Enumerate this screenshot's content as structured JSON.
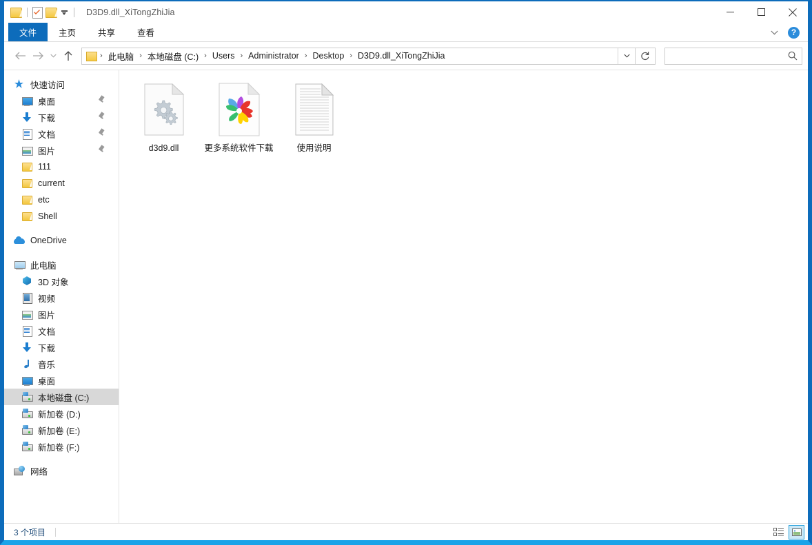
{
  "window": {
    "title": "D3D9.dll_XiTongZhiJia",
    "accent_color": "#0d6cbb",
    "bottom_border_color": "#1aa3e8",
    "controls": {
      "minimize": "minimize-icon",
      "maximize": "maximize-icon",
      "close": "close-icon"
    },
    "quick_access_toolbar": [
      {
        "name": "folder-icon",
        "label": ""
      },
      {
        "name": "properties-icon",
        "label": ""
      },
      {
        "name": "new-folder-icon",
        "label": ""
      },
      {
        "name": "customize-dropdown",
        "label": ""
      }
    ]
  },
  "ribbon": {
    "tabs": [
      {
        "id": "file",
        "label": "文件",
        "active": true
      },
      {
        "id": "home",
        "label": "主页",
        "active": false
      },
      {
        "id": "share",
        "label": "共享",
        "active": false
      },
      {
        "id": "view",
        "label": "查看",
        "active": false
      }
    ],
    "collapse_icon": "chevron-down-icon",
    "help_label": "?"
  },
  "address_bar": {
    "back_tooltip": "",
    "forward_tooltip": "",
    "up_tooltip": "",
    "breadcrumbs": [
      "此电脑",
      "本地磁盘 (C:)",
      "Users",
      "Administrator",
      "Desktop",
      "D3D9.dll_XiTongZhiJia"
    ],
    "separator": "›",
    "dropdown_icon": "chevron-down-icon",
    "refresh_icon": "refresh-icon"
  },
  "search": {
    "value": "",
    "placeholder": "",
    "icon": "search-icon"
  },
  "sidebar": {
    "groups": [
      {
        "header": {
          "label": "快速访问",
          "icon": "star-pin-icon"
        },
        "items": [
          {
            "label": "桌面",
            "icon": "desktop-icon",
            "pinned": true
          },
          {
            "label": "下载",
            "icon": "download-icon",
            "pinned": true
          },
          {
            "label": "文档",
            "icon": "documents-icon",
            "pinned": true
          },
          {
            "label": "图片",
            "icon": "pictures-icon",
            "pinned": true
          },
          {
            "label": "111",
            "icon": "folder-icon",
            "pinned": false
          },
          {
            "label": "current",
            "icon": "folder-icon",
            "pinned": false
          },
          {
            "label": "etc",
            "icon": "folder-icon",
            "pinned": false
          },
          {
            "label": "Shell",
            "icon": "folder-icon",
            "pinned": false
          }
        ]
      },
      {
        "header": {
          "label": "OneDrive",
          "icon": "onedrive-cloud-icon"
        },
        "items": []
      },
      {
        "header": {
          "label": "此电脑",
          "icon": "this-pc-icon"
        },
        "items": [
          {
            "label": "3D 对象",
            "icon": "3d-objects-icon",
            "pinned": false
          },
          {
            "label": "视频",
            "icon": "videos-icon",
            "pinned": false
          },
          {
            "label": "图片",
            "icon": "pictures-icon",
            "pinned": false
          },
          {
            "label": "文档",
            "icon": "documents-icon",
            "pinned": false
          },
          {
            "label": "下载",
            "icon": "download-icon",
            "pinned": false
          },
          {
            "label": "音乐",
            "icon": "music-icon",
            "pinned": false
          },
          {
            "label": "桌面",
            "icon": "desktop-icon",
            "pinned": false
          },
          {
            "label": "本地磁盘 (C:)",
            "icon": "local-disk-icon",
            "selected": true
          },
          {
            "label": "新加卷 (D:)",
            "icon": "drive-icon",
            "pinned": false
          },
          {
            "label": "新加卷 (E:)",
            "icon": "drive-icon",
            "pinned": false
          },
          {
            "label": "新加卷 (F:)",
            "icon": "drive-icon",
            "pinned": false
          }
        ]
      },
      {
        "header": {
          "label": "网络",
          "icon": "network-icon"
        },
        "items": []
      }
    ]
  },
  "files": [
    {
      "name": "d3d9.dll",
      "icon": "dll-gears-icon"
    },
    {
      "name": "更多系统软件下载",
      "icon": "pinwheel-shortcut-icon"
    },
    {
      "name": "使用说明",
      "icon": "text-document-icon"
    }
  ],
  "status_bar": {
    "item_count_text": "3 个项目",
    "views": [
      {
        "name": "details-view",
        "active": false
      },
      {
        "name": "large-icons-view",
        "active": true
      }
    ]
  }
}
